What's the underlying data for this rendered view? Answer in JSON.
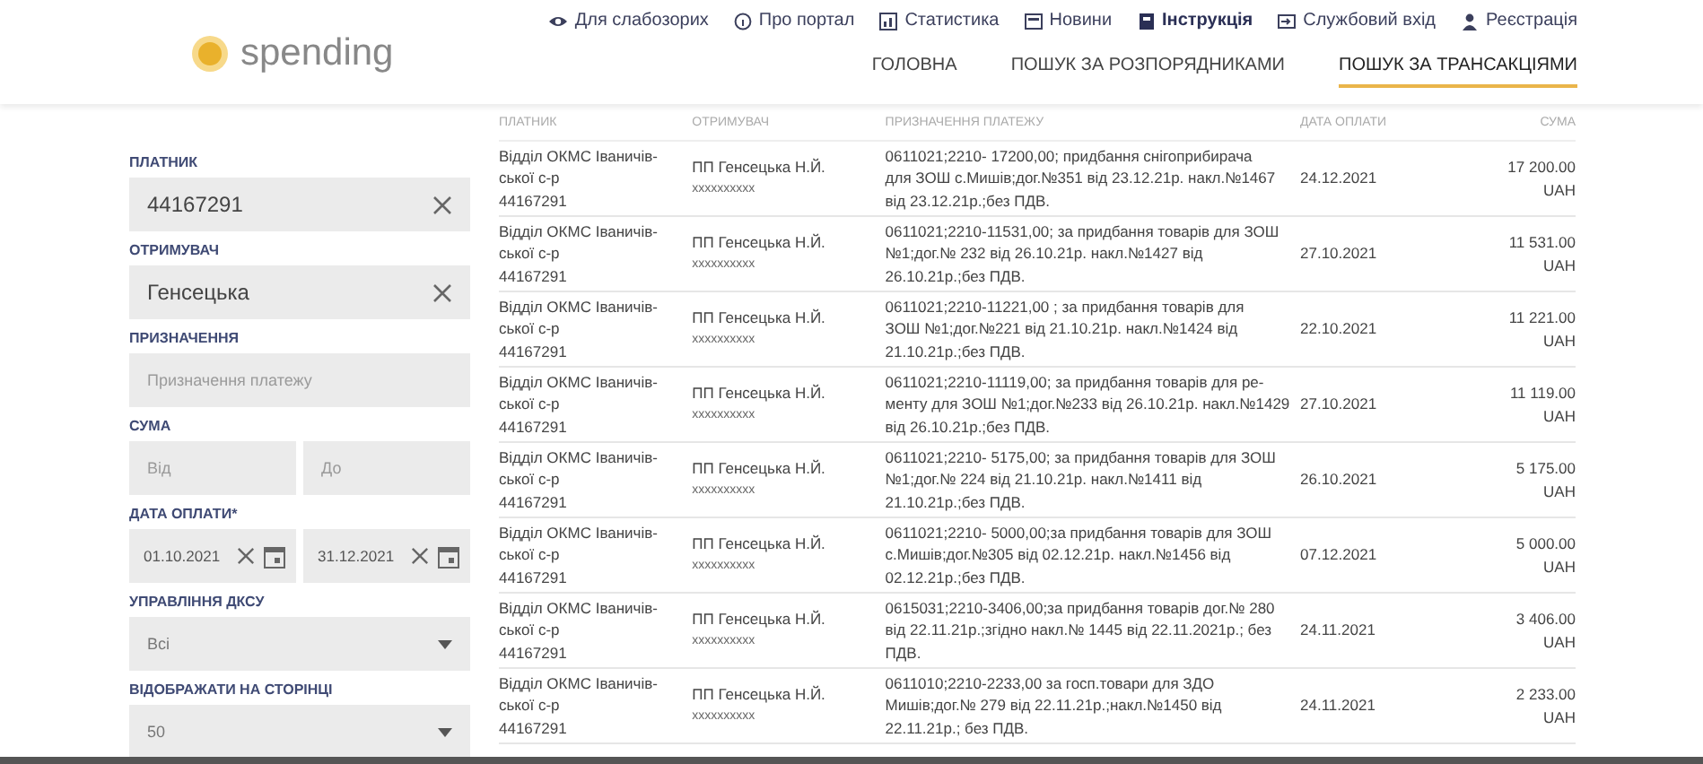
{
  "logo": {
    "text": "spending"
  },
  "top_links": [
    {
      "label": "Для слабозорих",
      "bold": false
    },
    {
      "label": "Про портал",
      "bold": false
    },
    {
      "label": "Статистика",
      "bold": false
    },
    {
      "label": "Новини",
      "bold": false
    },
    {
      "label": "Інструкція",
      "bold": true
    },
    {
      "label": "Службовий вхід",
      "bold": false
    },
    {
      "label": "Реєстрація",
      "bold": false
    }
  ],
  "tabs": [
    {
      "label": "ГОЛОВНА",
      "selected": false
    },
    {
      "label": "ПОШУК ЗА РОЗПОРЯДНИКАМИ",
      "selected": false
    },
    {
      "label": "ПОШУК ЗА ТРАНСАКЦІЯМИ",
      "selected": true
    }
  ],
  "filters": [
    {
      "kind": "text",
      "label": "ПЛАТНИК",
      "value": "44167291"
    },
    {
      "kind": "text",
      "label": "ОТРИМУВАЧ",
      "value": "Генсецька"
    },
    {
      "kind": "placeholder",
      "label": "ПРИЗНАЧЕННЯ",
      "placeholder": "Призначення платежу"
    },
    {
      "kind": "range",
      "label": "СУМА",
      "from_placeholder": "Від",
      "to_placeholder": "До"
    },
    {
      "kind": "dates",
      "label": "ДАТА ОПЛАТИ*",
      "from": "01.10.2021",
      "to": "31.12.2021"
    },
    {
      "kind": "select",
      "label": "УПРАВЛІННЯ ДКСУ",
      "value": "Всі"
    },
    {
      "kind": "select",
      "label": "ВІДОБРАЖАТИ НА СТОРІНЦІ",
      "value": "50"
    }
  ],
  "table": {
    "columns": [
      "ПЛАТНИК",
      "ОТРИМУВАЧ",
      "ПРИЗНАЧЕННЯ ПЛАТЕЖУ",
      "ДАТА ОПЛАТИ",
      "СУМА"
    ],
    "rows": [
      {
        "payer": "Відділ ОКМС Іваничів-\nської с-р\n44167291",
        "recipient": "ПП Генсецька Н.Й.",
        "recipient_code": "xxxxxxxxxx",
        "purpose": "0611021;2210- 17200,00; придбання снігоприбирача\nдля ЗОШ с.Мишів;дог.№351 від 23.12.21р. накл.№1467\nвід 23.12.21р.;без ПДВ.",
        "date": "24.12.2021",
        "sum": "17 200.00",
        "currency": "UAH"
      },
      {
        "payer": "Відділ ОКМС Іваничів-\nської с-р\n44167291",
        "recipient": "ПП Генсецька Н.Й.",
        "recipient_code": "xxxxxxxxxx",
        "purpose": "0611021;2210-11531,00; за придбання товарів для ЗОШ\n№1;дог.№ 232 від 26.10.21р. накл.№1427 від\n26.10.21р.;без ПДВ.",
        "date": "27.10.2021",
        "sum": "11 531.00",
        "currency": "UAH"
      },
      {
        "payer": "Відділ ОКМС Іваничів-\nської с-р\n44167291",
        "recipient": "ПП Генсецька Н.Й.",
        "recipient_code": "xxxxxxxxxx",
        "purpose": "0611021;2210-11221,00 ; за придбання товарів для\nЗОШ №1;дог.№221 від 21.10.21р. накл.№1424 від\n21.10.21р.;без ПДВ.",
        "date": "22.10.2021",
        "sum": "11 221.00",
        "currency": "UAH"
      },
      {
        "payer": "Відділ ОКМС Іваничів-\nської с-р\n44167291",
        "recipient": "ПП Генсецька Н.Й.",
        "recipient_code": "xxxxxxxxxx",
        "purpose": "0611021;2210-11119,00; за придбання товарів для ре-\nменту для ЗОШ №1;дог.№233 від 26.10.21р. накл.№1429\nвід 26.10.21р.;без ПДВ.",
        "date": "27.10.2021",
        "sum": "11 119.00",
        "currency": "UAH"
      },
      {
        "payer": "Відділ ОКМС Іваничів-\nської с-р\n44167291",
        "recipient": "ПП Генсецька Н.Й.",
        "recipient_code": "xxxxxxxxxx",
        "purpose": "0611021;2210- 5175,00; за придбання товарів для ЗОШ\n№1;дог.№ 224 від 21.10.21р. накл.№1411 від\n21.10.21р.;без ПДВ.",
        "date": "26.10.2021",
        "sum": "5 175.00",
        "currency": "UAH"
      },
      {
        "payer": "Відділ ОКМС Іваничів-\nської с-р\n44167291",
        "recipient": "ПП Генсецька Н.Й.",
        "recipient_code": "xxxxxxxxxx",
        "purpose": "0611021;2210- 5000,00;за придбання товарів для ЗОШ\nс.Мишів;дог.№305 від 02.12.21р. накл.№1456 від\n02.12.21р.;без ПДВ.",
        "date": "07.12.2021",
        "sum": "5 000.00",
        "currency": "UAH"
      },
      {
        "payer": "Відділ ОКМС Іваничів-\nської с-р\n44167291",
        "recipient": "ПП Генсецька Н.Й.",
        "recipient_code": "xxxxxxxxxx",
        "purpose": "0615031;2210-3406,00;за придбання товарів дог.№ 280\nвід 22.11.21р.;згідно накл.№ 1445 від 22.11.2021р.; без\nПДВ.",
        "date": "24.11.2021",
        "sum": "3 406.00",
        "currency": "UAH"
      },
      {
        "payer": "Відділ ОКМС Іваничів-\nської с-р\n44167291",
        "recipient": "ПП Генсецька Н.Й.",
        "recipient_code": "xxxxxxxxxx",
        "purpose": "0611010;2210-2233,00 за госп.товари для ЗДО\nМишів;дог.№ 279 від 22.11.21р.;накл.№1450 від\n22.11.21р.; без ПДВ.",
        "date": "24.11.2021",
        "sum": "2 233.00",
        "currency": "UAH"
      }
    ]
  }
}
